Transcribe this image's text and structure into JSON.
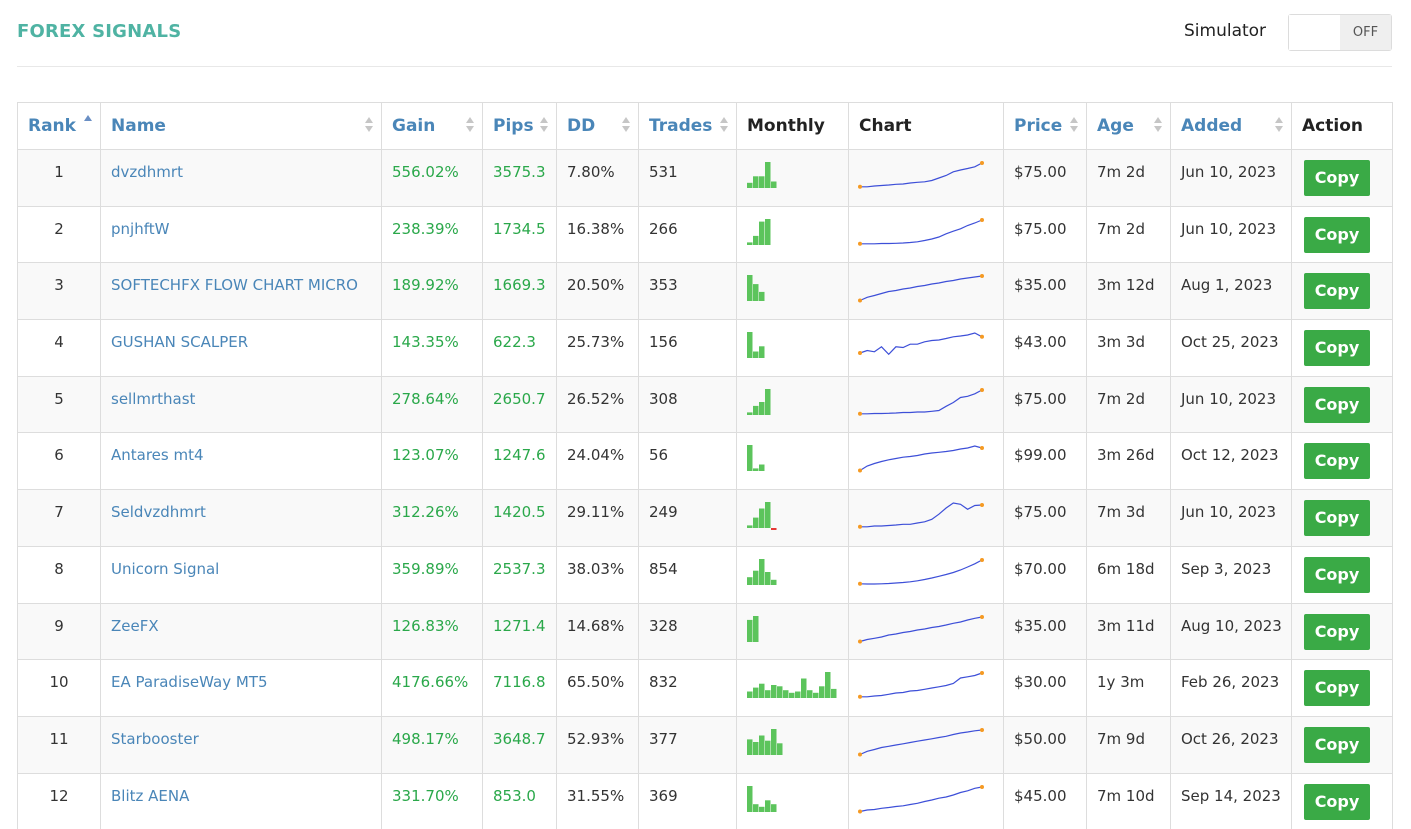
{
  "header": {
    "title": "FOREX SIGNALS",
    "simulator_label": "Simulator",
    "simulator_state": "OFF"
  },
  "table": {
    "columns": [
      "Rank",
      "Name",
      "Gain",
      "Pips",
      "DD",
      "Trades",
      "Monthly",
      "Chart",
      "Price",
      "Age",
      "Added",
      "Action"
    ],
    "rows": [
      {
        "rank": "1",
        "name": "dvzdhmrt",
        "gain": "556.02%",
        "pips": "3575.3",
        "dd": "7.80%",
        "trades": "531",
        "price": "$75.00",
        "age": "7m 2d",
        "added": "Jun 10, 2023",
        "action": "Copy",
        "monthly": [
          0.2,
          0.45,
          0.45,
          1.0,
          0.25
        ],
        "chart": [
          0.05,
          0.05,
          0.08,
          0.1,
          0.12,
          0.15,
          0.16,
          0.2,
          0.23,
          0.25,
          0.3,
          0.4,
          0.5,
          0.65,
          0.72,
          0.78,
          0.85,
          1.0
        ]
      },
      {
        "rank": "2",
        "name": "pnjhftW",
        "gain": "238.39%",
        "pips": "1734.5",
        "dd": "16.38%",
        "trades": "266",
        "price": "$75.00",
        "age": "7m 2d",
        "added": "Jun 10, 2023",
        "action": "Copy",
        "monthly": [
          0.1,
          0.35,
          0.9,
          1.0
        ],
        "chart": [
          0.05,
          0.05,
          0.05,
          0.06,
          0.06,
          0.07,
          0.08,
          0.1,
          0.13,
          0.18,
          0.24,
          0.32,
          0.45,
          0.55,
          0.65,
          0.78,
          0.88,
          1.0
        ]
      },
      {
        "rank": "3",
        "name": "SOFTECHFX FLOW CHART MICRO",
        "gain": "189.92%",
        "pips": "1669.3",
        "dd": "20.50%",
        "trades": "353",
        "price": "$35.00",
        "age": "3m 12d",
        "added": "Aug 1, 2023",
        "action": "Copy",
        "monthly": [
          1.0,
          0.65,
          0.35
        ],
        "chart": [
          0.02,
          0.15,
          0.22,
          0.3,
          0.38,
          0.42,
          0.48,
          0.52,
          0.58,
          0.62,
          0.68,
          0.72,
          0.78,
          0.82,
          0.88,
          0.92,
          0.96,
          1.0
        ]
      },
      {
        "rank": "4",
        "name": "GUSHAN SCALPER",
        "gain": "143.35%",
        "pips": "622.3",
        "dd": "25.73%",
        "trades": "156",
        "price": "$43.00",
        "age": "3m 3d",
        "added": "Oct 25, 2023",
        "action": "Copy",
        "monthly": [
          1.0,
          0.25,
          0.45
        ],
        "chart": [
          0.2,
          0.3,
          0.25,
          0.45,
          0.15,
          0.45,
          0.42,
          0.55,
          0.55,
          0.65,
          0.7,
          0.72,
          0.78,
          0.85,
          0.88,
          0.92,
          1.0,
          0.85
        ]
      },
      {
        "rank": "5",
        "name": "sellmrthast",
        "gain": "278.64%",
        "pips": "2650.7",
        "dd": "26.52%",
        "trades": "308",
        "price": "$75.00",
        "age": "7m 2d",
        "added": "Jun 10, 2023",
        "action": "Copy",
        "monthly": [
          0.1,
          0.35,
          0.5,
          1.0
        ],
        "chart": [
          0.05,
          0.05,
          0.06,
          0.06,
          0.07,
          0.08,
          0.1,
          0.1,
          0.12,
          0.12,
          0.15,
          0.18,
          0.35,
          0.5,
          0.7,
          0.75,
          0.85,
          1.0
        ]
      },
      {
        "rank": "6",
        "name": "Antares mt4",
        "gain": "123.07%",
        "pips": "1247.6",
        "dd": "24.04%",
        "trades": "56",
        "price": "$99.00",
        "age": "3m 26d",
        "added": "Oct 12, 2023",
        "action": "Copy",
        "monthly": [
          1.0,
          0.1,
          0.25
        ],
        "chart": [
          0.02,
          0.2,
          0.3,
          0.38,
          0.45,
          0.5,
          0.55,
          0.58,
          0.62,
          0.68,
          0.72,
          0.75,
          0.78,
          0.82,
          0.88,
          0.92,
          1.0,
          0.92
        ]
      },
      {
        "rank": "7",
        "name": "Seldvzdhmrt",
        "gain": "312.26%",
        "pips": "1420.5",
        "dd": "29.11%",
        "trades": "249",
        "price": "$75.00",
        "age": "7m 3d",
        "added": "Jun 10, 2023",
        "action": "Copy",
        "monthly": [
          0.1,
          0.4,
          0.75,
          1.0,
          -0.1
        ],
        "chart": [
          0.05,
          0.05,
          0.08,
          0.08,
          0.1,
          0.12,
          0.15,
          0.15,
          0.2,
          0.25,
          0.35,
          0.55,
          0.8,
          1.0,
          0.95,
          0.75,
          0.9,
          0.92
        ]
      },
      {
        "rank": "8",
        "name": "Unicorn Signal",
        "gain": "359.89%",
        "pips": "2537.3",
        "dd": "38.03%",
        "trades": "854",
        "price": "$70.00",
        "age": "6m 18d",
        "added": "Sep 3, 2023",
        "action": "Copy",
        "monthly": [
          0.3,
          0.55,
          1.0,
          0.5,
          0.2
        ],
        "chart": [
          0.05,
          0.04,
          0.04,
          0.05,
          0.06,
          0.08,
          0.1,
          0.13,
          0.17,
          0.22,
          0.28,
          0.35,
          0.42,
          0.5,
          0.6,
          0.72,
          0.85,
          1.0
        ]
      },
      {
        "rank": "9",
        "name": "ZeeFX",
        "gain": "126.83%",
        "pips": "1271.4",
        "dd": "14.68%",
        "trades": "328",
        "price": "$35.00",
        "age": "3m 11d",
        "added": "Aug 10, 2023",
        "action": "Copy",
        "monthly": [
          0.85,
          1.0
        ],
        "chart": [
          0.02,
          0.1,
          0.15,
          0.2,
          0.28,
          0.32,
          0.38,
          0.42,
          0.48,
          0.52,
          0.58,
          0.62,
          0.68,
          0.75,
          0.8,
          0.88,
          0.95,
          1.0
        ]
      },
      {
        "rank": "10",
        "name": "EA ParadiseWay MT5",
        "gain": "4176.66%",
        "pips": "7116.8",
        "dd": "65.50%",
        "trades": "832",
        "price": "$30.00",
        "age": "1y 3m",
        "added": "Feb 26, 2023",
        "action": "Copy",
        "monthly": [
          0.25,
          0.4,
          0.55,
          0.3,
          0.5,
          0.45,
          0.3,
          0.2,
          0.25,
          0.75,
          0.3,
          0.2,
          0.45,
          1.0,
          0.35
        ],
        "chart": [
          0.05,
          0.05,
          0.08,
          0.1,
          0.15,
          0.2,
          0.22,
          0.28,
          0.3,
          0.35,
          0.4,
          0.45,
          0.5,
          0.58,
          0.8,
          0.85,
          0.9,
          1.0
        ]
      },
      {
        "rank": "11",
        "name": "Starbooster",
        "gain": "498.17%",
        "pips": "3648.7",
        "dd": "52.93%",
        "trades": "377",
        "price": "$50.00",
        "age": "7m 9d",
        "added": "Oct 26, 2023",
        "action": "Copy",
        "monthly": [
          0.6,
          0.5,
          0.75,
          0.55,
          1.0,
          0.45
        ],
        "chart": [
          0.02,
          0.15,
          0.22,
          0.3,
          0.35,
          0.4,
          0.45,
          0.5,
          0.55,
          0.6,
          0.65,
          0.7,
          0.75,
          0.82,
          0.88,
          0.92,
          0.97,
          1.0
        ]
      },
      {
        "rank": "12",
        "name": "Blitz AENA",
        "gain": "331.70%",
        "pips": "853.0",
        "dd": "31.55%",
        "trades": "369",
        "price": "$45.00",
        "age": "7m 10d",
        "added": "Sep 14, 2023",
        "action": "Copy",
        "monthly": [
          1.0,
          0.3,
          0.2,
          0.45,
          0.3
        ],
        "chart": [
          0.02,
          0.08,
          0.1,
          0.15,
          0.18,
          0.22,
          0.25,
          0.3,
          0.35,
          0.42,
          0.48,
          0.55,
          0.6,
          0.68,
          0.78,
          0.85,
          0.95,
          1.0
        ]
      }
    ]
  },
  "colors": {
    "title": "#4fb3a3",
    "header_link": "#4a86b8",
    "gain": "#2aa84a",
    "bar": "#5cc45c",
    "bar_negative": "#e53935",
    "line": "#3d4fd8",
    "endpoint": "#f59a23",
    "copy_button": "#3aaa46"
  },
  "icons": {
    "sort": "sort-both-icon",
    "sort_asc": "sort-asc-icon"
  }
}
